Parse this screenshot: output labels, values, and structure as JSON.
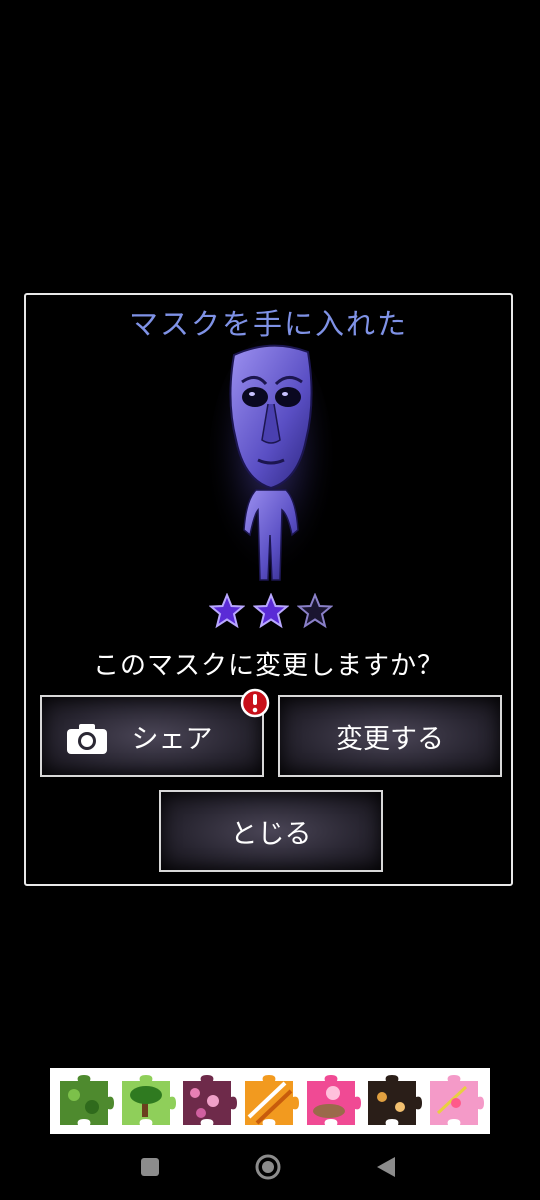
{
  "dialog": {
    "title": "マスクを手に入れた",
    "question": "このマスクに変更しますか？",
    "rating": {
      "filled": 2,
      "total": 3
    },
    "buttons": {
      "share_label": "シェア",
      "change_label": "変更する",
      "close_label": "とじる"
    }
  },
  "colors": {
    "title": "#7f92e6",
    "star_filled": "#5a2bd6",
    "figure": "#6a5fd0",
    "alert_badge": "#c8101a"
  },
  "ad_banner": {
    "tiles": [
      "green-foliage",
      "bonsai-tree",
      "pink-flowers",
      "orange-stripes",
      "pink-flower-bowl",
      "dark-sweets",
      "pink-candy"
    ]
  },
  "navbar": {
    "buttons": [
      "recent-apps",
      "home",
      "back"
    ]
  }
}
